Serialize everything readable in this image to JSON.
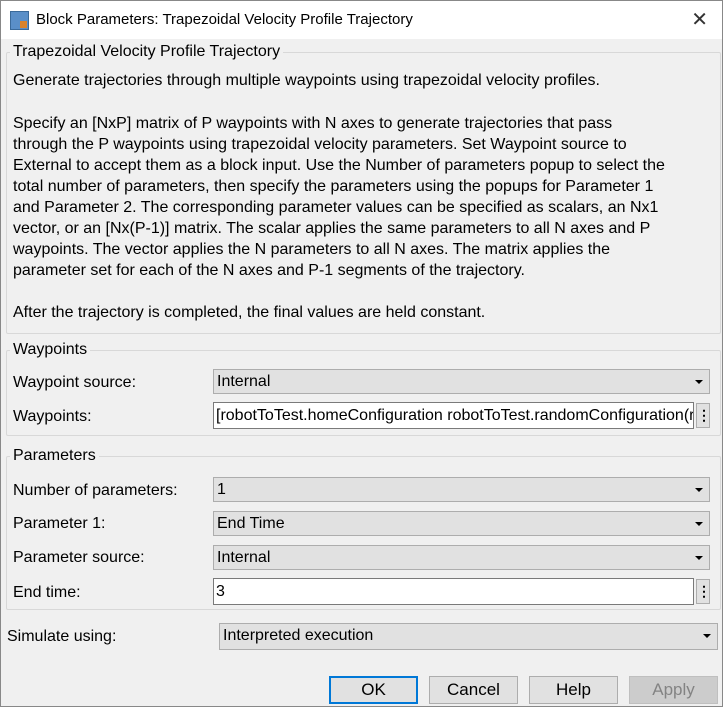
{
  "window": {
    "title": "Block Parameters: Trapezoidal Velocity Profile Trajectory",
    "close": "✕"
  },
  "description": {
    "heading": "Trapezoidal Velocity Profile Trajectory",
    "lines": [
      "Generate trajectories through multiple waypoints using trapezoidal velocity profiles.",
      "Specify an [NxP] matrix of P waypoints with N axes to generate trajectories that pass",
      "through the P waypoints using trapezoidal velocity parameters. Set Waypoint source to",
      "External to accept them as a block input. Use the Number of parameters popup to select the",
      "total number of parameters, then specify the parameters using the popups for Parameter 1",
      "and Parameter 2. The corresponding parameter values can be specified as scalars, an Nx1",
      "vector, or an [Nx(P-1)] matrix. The scalar applies the same parameters to all N axes and P",
      "waypoints. The vector applies the N parameters to all N axes. The matrix applies the",
      "parameter set for each of the N axes and P-1 segments of the trajectory.",
      "After the trajectory is completed, the final values are held constant."
    ]
  },
  "waypoints": {
    "heading": "Waypoints",
    "source_label": "Waypoint source:",
    "source_value": "Internal",
    "waypoints_label": "Waypoints:",
    "waypoints_value": "[robotToTest.homeConfiguration robotToTest.randomConfiguration(robotToTest)]"
  },
  "parameters": {
    "heading": "Parameters",
    "num_label": "Number of parameters:",
    "num_value": "1",
    "p1_label": "Parameter 1:",
    "p1_value": "End Time",
    "src_label": "Parameter source:",
    "src_value": "Internal",
    "end_label": "End time:",
    "end_value": "3"
  },
  "simulate": {
    "label": "Simulate using:",
    "value": "Interpreted execution"
  },
  "buttons": {
    "ok": "OK",
    "cancel": "Cancel",
    "help": "Help",
    "apply": "Apply"
  },
  "more_glyph": "⋮"
}
